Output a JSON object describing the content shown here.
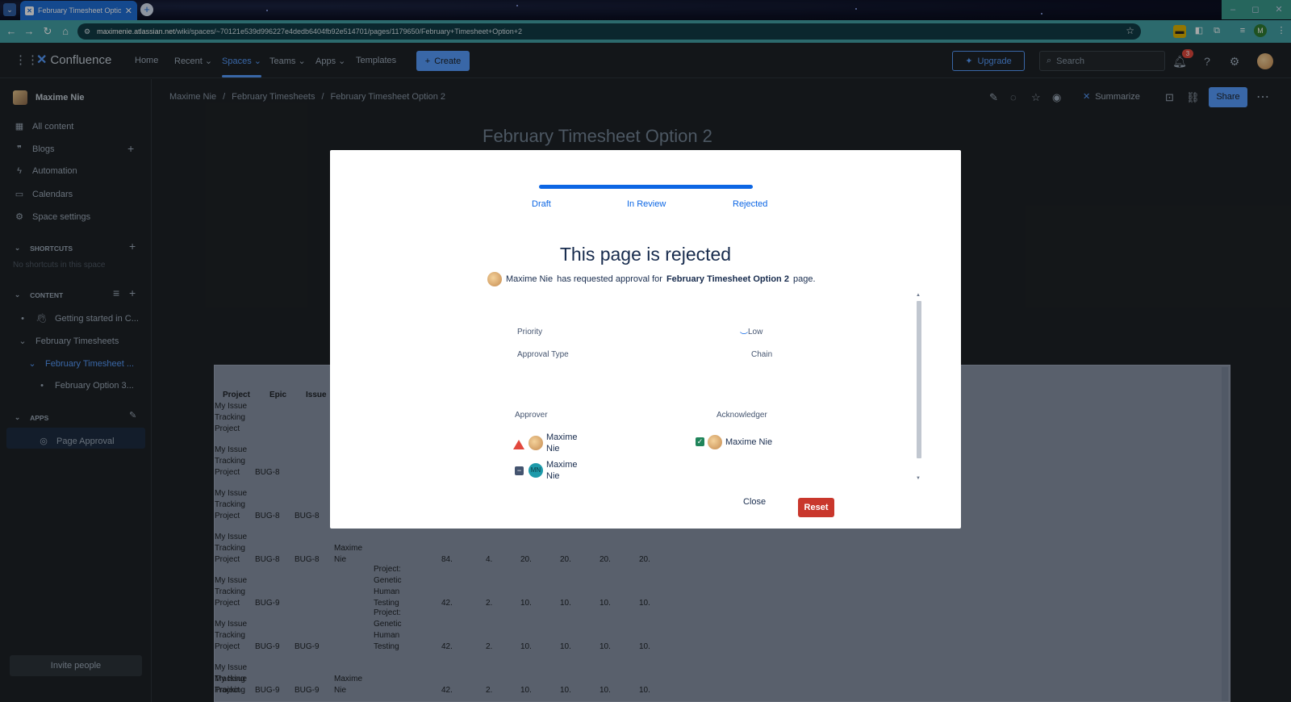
{
  "browser": {
    "tab_title": "February Timesheet Option 2",
    "url_domain": "maximenie.atlassian.net",
    "url_path": "/wiki/spaces/~70121e539d996227e4dedb6404fb92e514701/pages/1179650/February+Timesheet+Option+2",
    "profile_initial": "M"
  },
  "topnav": {
    "logo": "Confluence",
    "items": [
      "Home",
      "Recent",
      "Spaces",
      "Teams",
      "Apps",
      "Templates"
    ],
    "create": "Create",
    "upgrade": "Upgrade",
    "search_placeholder": "Search",
    "notification_count": "3"
  },
  "sidebar": {
    "space_name": "Maxime Nie",
    "items": [
      "All content",
      "Blogs",
      "Automation",
      "Calendars",
      "Space settings"
    ],
    "shortcuts_header": "SHORTCUTS",
    "shortcuts_empty": "No shortcuts in this space",
    "content_header": "CONTENT",
    "tree": [
      "Getting started in C...",
      "February Timesheets",
      "February Timesheet ...",
      "February Option 3..."
    ],
    "apps_header": "APPS",
    "apps": [
      "Page Approval"
    ],
    "invite": "Invite people"
  },
  "page": {
    "breadcrumbs": [
      "Maxime Nie",
      "/",
      "February Timesheets",
      "/",
      "February Timesheet Option 2"
    ],
    "title": "February Timesheet Option 2",
    "summarize": "Summarize",
    "share": "Share"
  },
  "table": {
    "headers": [
      "Project",
      "Epic",
      "Issue"
    ],
    "project_lines": [
      "My Issue",
      "Tracking",
      "Project"
    ],
    "rows": [
      {
        "epic": "",
        "issue": "",
        "assignee": "",
        "desc": "",
        "nums": []
      },
      {
        "epic": "BUG-8",
        "issue": "",
        "assignee": "",
        "desc": "",
        "nums": []
      },
      {
        "epic": "BUG-8",
        "issue": "BUG-8",
        "assignee": "",
        "desc": "",
        "nums": []
      },
      {
        "epic": "BUG-8",
        "issue": "BUG-8",
        "assignee": "Maxime Nie",
        "desc": "",
        "nums": [
          "84.",
          "4.",
          "20.",
          "20.",
          "20.",
          "20."
        ]
      },
      {
        "epic": "BUG-9",
        "issue": "",
        "assignee": "",
        "desc": "Project: Genetic Human Testing",
        "nums": [
          "42.",
          "2.",
          "10.",
          "10.",
          "10.",
          "10."
        ]
      },
      {
        "epic": "BUG-9",
        "issue": "BUG-9",
        "assignee": "",
        "desc": "Project: Genetic Human Testing",
        "nums": [
          "42.",
          "2.",
          "10.",
          "10.",
          "10.",
          "10."
        ]
      },
      {
        "epic": "BUG-9",
        "issue": "BUG-9",
        "assignee": "Maxime Nie",
        "desc": "",
        "nums": [
          "42.",
          "2.",
          "10.",
          "10.",
          "10.",
          "10."
        ]
      }
    ],
    "last_lines": [
      "My Issue",
      "Tracking"
    ]
  },
  "modal": {
    "steps": [
      "Draft",
      "In Review",
      "Rejected"
    ],
    "progress": 1.0,
    "title": "This page is rejected",
    "requester": "Maxime Nie",
    "request_text": "has requested approval for",
    "page_name": "February Timesheet Option 2",
    "page_suffix": "page.",
    "priority_label": "Priority",
    "priority_value": "Low",
    "approval_type_label": "Approval Type",
    "approval_type_value": "Chain",
    "approver_label": "Approver",
    "acknowledger_label": "Acknowledger",
    "approvers": [
      {
        "name": "Maxime Nie",
        "status": "rejected",
        "avatar": "photo"
      },
      {
        "name": "Maxime Nie",
        "status": "pending",
        "avatar": "MN"
      }
    ],
    "acknowledger": {
      "name": "Maxime Nie",
      "status": "acknowledged"
    },
    "close": "Close",
    "reset": "Reset"
  },
  "colors": {
    "accent": "#579dff",
    "progress": "#0c66e4",
    "reset": "#c9372c",
    "warning": "#e2483d",
    "success": "#1f845a"
  }
}
